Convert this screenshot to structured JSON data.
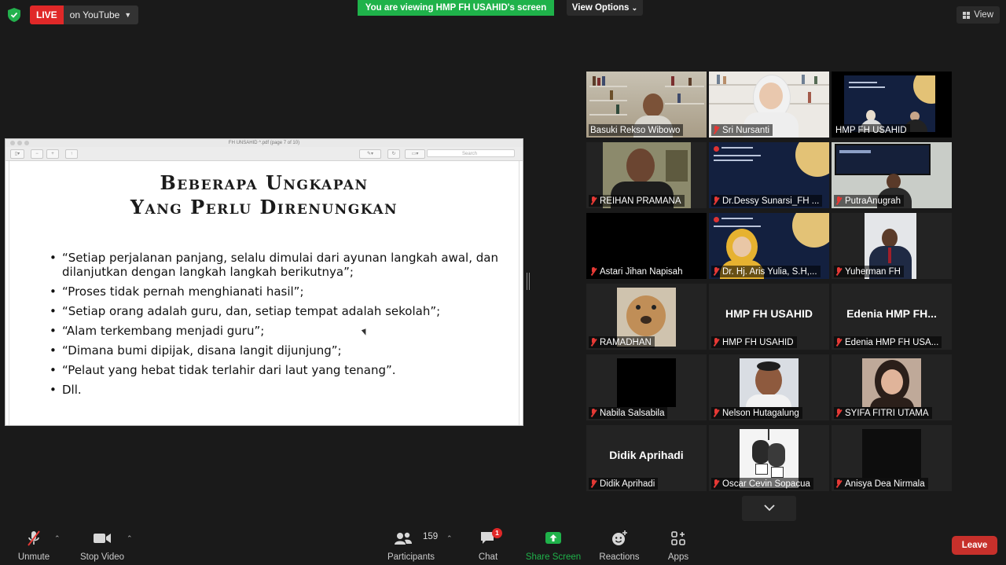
{
  "topbar": {
    "live_label": "LIVE",
    "stream_target": "on YouTube",
    "viewing_banner": "You are viewing HMP FH USAHID's screen",
    "view_options": "View Options",
    "view_label": "View"
  },
  "shared_screen": {
    "window_title": "FH UNSAHID ^.pdf (page 7 of 10)",
    "search_placeholder": "Search",
    "slide_title_line1": "Beberapa Ungkapan",
    "slide_title_line2": "Yang Perlu Direnungkan",
    "bullets": [
      "“Setiap perjalanan panjang, selalu dimulai dari ayunan langkah awal, dan dilanjutkan dengan langkah langkah berikutnya”;",
      "“Proses tidak pernah menghianati hasil”;",
      "“Setiap orang adalah guru, dan,  setiap tempat adalah sekolah”;",
      "“Alam terkembang menjadi guru”;",
      "“Dimana bumi dipijak, disana langit dijunjung”;",
      "“Pelaut yang hebat tidak terlahir dari laut yang tenang”.",
      "Dll."
    ]
  },
  "participants": [
    {
      "name": "Basuki Rekso Wibowo",
      "muted": false,
      "active": true
    },
    {
      "name": "Sri Nursanti",
      "muted": true
    },
    {
      "name": "HMP FH USAHID",
      "muted": false
    },
    {
      "name": "REIHAN PRAMANA",
      "muted": true
    },
    {
      "name": "Dr.Dessy Sunarsi_FH ...",
      "muted": true
    },
    {
      "name": "PutraAnugrah",
      "muted": true
    },
    {
      "name": "Astari Jihan Napisah",
      "muted": true
    },
    {
      "name": "Dr. Hj. Aris Yulia, S.H,...",
      "muted": true
    },
    {
      "name": "Yuherman FH",
      "muted": true
    },
    {
      "name": "RAMADHAN",
      "muted": true
    },
    {
      "name": "HMP FH USAHID",
      "muted": true,
      "display_name": "HMP FH USAHID"
    },
    {
      "name": "Edenia HMP FH USA...",
      "muted": true,
      "display_name": "Edenia  HMP  FH..."
    },
    {
      "name": "Nabila Salsabila",
      "muted": true
    },
    {
      "name": "Nelson Hutagalung",
      "muted": true
    },
    {
      "name": "SYIFA FITRI UTAMA",
      "muted": true
    },
    {
      "name": "Didik Aprihadi",
      "muted": true,
      "display_name": "Didik Aprihadi"
    },
    {
      "name": "Oscar Cevin Sopacua",
      "muted": true
    },
    {
      "name": "Anisya Dea Nirmala",
      "muted": true
    }
  ],
  "toolbar": {
    "unmute": "Unmute",
    "stop_video": "Stop Video",
    "participants": "Participants",
    "participant_count": "159",
    "chat": "Chat",
    "chat_badge": "1",
    "share_screen": "Share Screen",
    "reactions": "Reactions",
    "apps": "Apps",
    "leave": "Leave"
  },
  "colors": {
    "banner_green": "#1fb24a",
    "live_red": "#e02828",
    "active_speaker": "#e5e83e",
    "leave_red": "#c7302b"
  }
}
